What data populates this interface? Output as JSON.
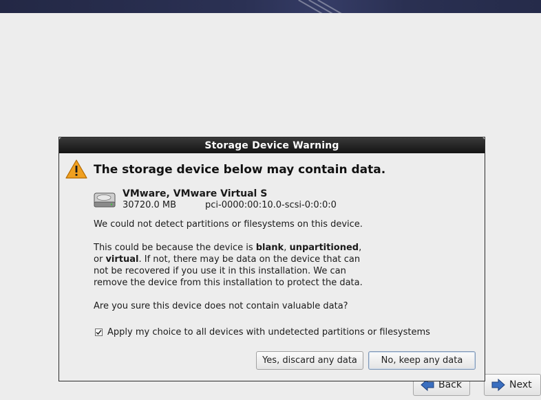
{
  "dialog": {
    "title": "Storage Device Warning",
    "headline": "The storage device below may contain data.",
    "device": {
      "name": "VMware, VMware Virtual S",
      "size": "30720.0 MB",
      "path": "pci-0000:00:10.0-scsi-0:0:0:0"
    },
    "message1": "We could not detect partitions or filesystems on this device.",
    "message2": {
      "t1": "This could be because the device is ",
      "b1": "blank",
      "t2": ", ",
      "b2": "unpartitioned",
      "t3": ", or ",
      "b3": "virtual",
      "t4": ". If not, there may be data on the device that can not be recovered if you use it in this installation. We can remove the device from this installation to protect the data."
    },
    "question": "Are you sure this device does not contain valuable data?",
    "checkbox": {
      "label": "Apply my choice to all devices with undetected partitions or filesystems",
      "checked": true
    },
    "buttons": {
      "yes": "Yes, discard any data",
      "no": "No, keep any data"
    }
  },
  "nav": {
    "back": "Back",
    "next": "Next"
  },
  "colors": {
    "warning_icon": "#f0a020",
    "next_arrow": "#3a6fc0",
    "back_arrow": "#3a6fc0"
  }
}
